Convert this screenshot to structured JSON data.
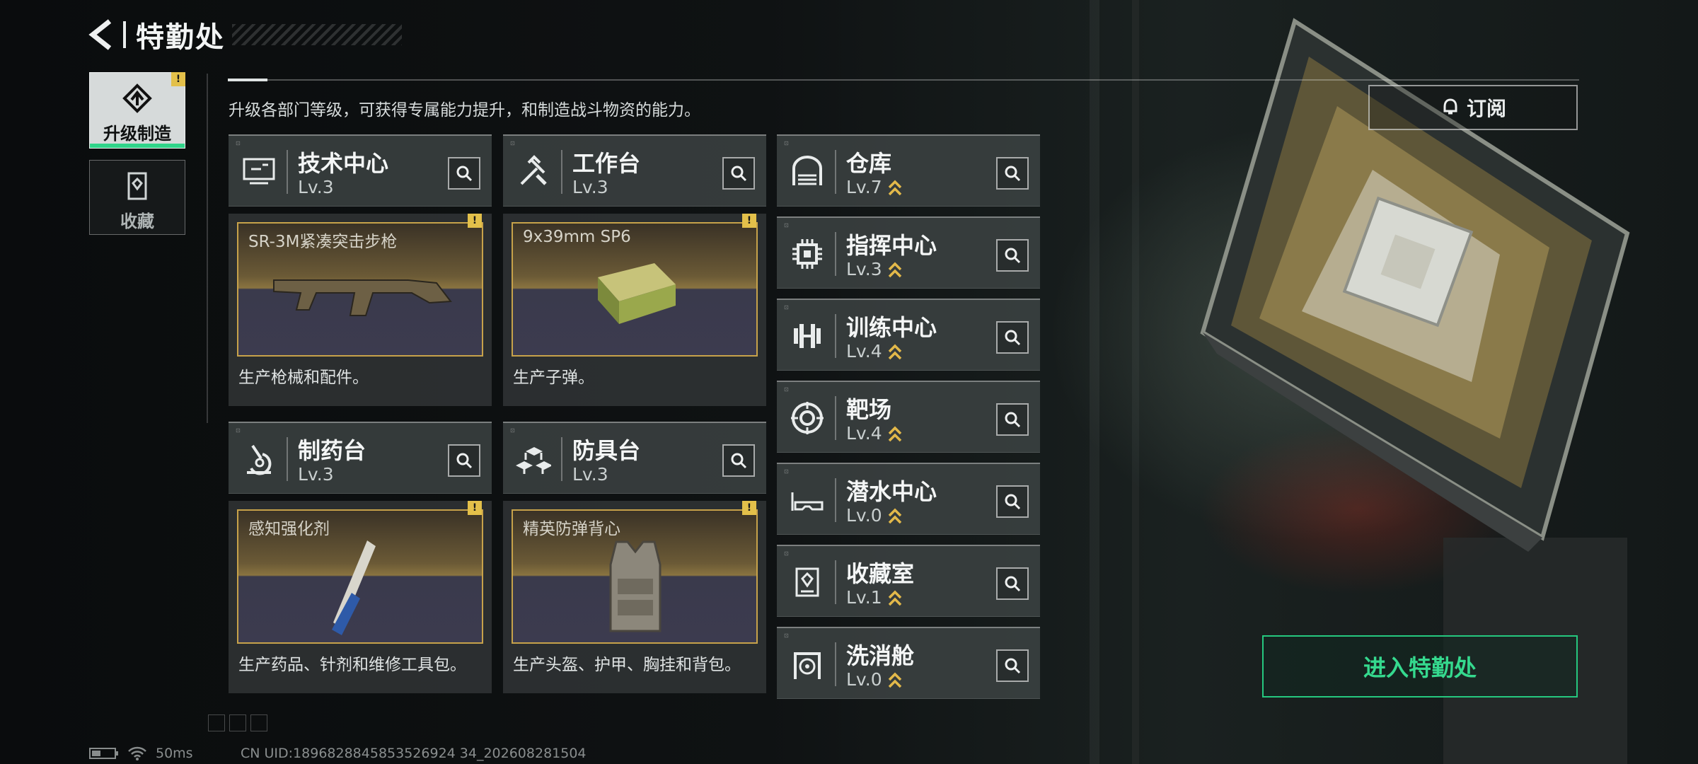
{
  "header": {
    "title": "特勤处"
  },
  "nav": [
    {
      "label": "升级制造",
      "active": true,
      "warning": "!"
    },
    {
      "label": "收藏",
      "active": false
    }
  ],
  "description": "升级各部门等级，可获得专属能力提升，和制造战斗物资的能力。",
  "departments": [
    {
      "name": "技术中心",
      "level": "Lv.3",
      "icon": "computer-icon"
    },
    {
      "name": "工作台",
      "level": "Lv.3",
      "icon": "tools-icon"
    },
    {
      "name": "制药台",
      "level": "Lv.3",
      "icon": "microscope-icon"
    },
    {
      "name": "防具台",
      "level": "Lv.3",
      "icon": "cubes-icon"
    }
  ],
  "production": [
    {
      "name": "SR-3M紧凑突击步枪",
      "desc": "生产枪械和配件。",
      "warning": "!",
      "icon": "rifle-icon"
    },
    {
      "name": "9x39mm SP6",
      "desc": "生产子弹。",
      "warning": "!",
      "icon": "ammo-box-icon"
    },
    {
      "name": "感知强化剂",
      "desc": "生产药品、针剂和维修工具包。",
      "warning": "!",
      "icon": "syringe-icon"
    },
    {
      "name": "精英防弹背心",
      "desc": "生产头盔、护甲、胸挂和背包。",
      "warning": "!",
      "icon": "vest-icon"
    }
  ],
  "facilities": [
    {
      "name": "仓库",
      "level": "Lv.7",
      "icon": "warehouse-icon"
    },
    {
      "name": "指挥中心",
      "level": "Lv.3",
      "icon": "chip-icon"
    },
    {
      "name": "训练中心",
      "level": "Lv.4",
      "icon": "dumbbell-icon"
    },
    {
      "name": "靶场",
      "level": "Lv.4",
      "icon": "target-icon"
    },
    {
      "name": "潜水中心",
      "level": "Lv.0",
      "icon": "goggles-icon"
    },
    {
      "name": "收藏室",
      "level": "Lv.1",
      "icon": "trophy-icon"
    },
    {
      "name": "洗消舱",
      "level": "Lv.0",
      "icon": "decon-icon"
    }
  ],
  "subscribe_label": "订阅",
  "enter_label": "进入特勤处",
  "status": {
    "ping": "50ms",
    "uid": "CN UID:1896828845853526924 34_202608281504"
  },
  "colors": {
    "accent": "#35d98e",
    "gold": "#c7a24a",
    "warning": "#e3c04a"
  }
}
